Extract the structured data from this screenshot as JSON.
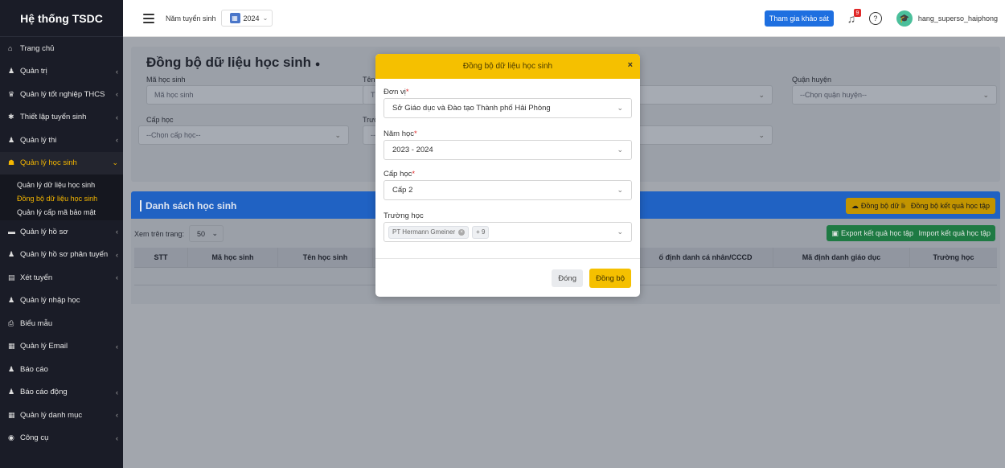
{
  "sidebar": {
    "brand": "Hệ thống TSDC",
    "items": [
      {
        "label": "Trang chủ",
        "icon": "home-icon",
        "glyph": "⌂",
        "chevron": false
      },
      {
        "label": "Quản trị",
        "icon": "users-icon",
        "glyph": "♟",
        "chevron": true
      },
      {
        "label": "Quản lý tốt nghiệp THCS",
        "icon": "trophy-icon",
        "glyph": "♛",
        "chevron": true
      },
      {
        "label": "Thiết lập tuyển sinh",
        "icon": "gear-icon",
        "glyph": "✱",
        "chevron": true
      },
      {
        "label": "Quản lý thi",
        "icon": "user-group-icon",
        "glyph": "♟",
        "chevron": true
      }
    ],
    "active_item": {
      "label": "Quản lý học sinh",
      "glyph": "☗",
      "chevron": "⌄"
    },
    "sub_items": [
      "Quản lý dữ liệu học sinh",
      "Đồng bộ dữ liệu học sinh",
      "Quản lý cấp mã bảo mật"
    ],
    "items_after": [
      {
        "label": "Quản lý hồ sơ",
        "glyph": "▬",
        "chevron": true
      },
      {
        "label": "Quản lý hồ sơ phân tuyến",
        "glyph": "♟",
        "chevron": true
      },
      {
        "label": "Xét tuyển",
        "glyph": "▤",
        "chevron": true
      },
      {
        "label": "Quản lý nhập học",
        "glyph": "♟",
        "chevron": false
      },
      {
        "label": "Biểu mẫu",
        "glyph": "⎙",
        "chevron": false
      },
      {
        "label": "Quản lý Email",
        "glyph": "▦",
        "chevron": true
      },
      {
        "label": "Báo cáo",
        "glyph": "♟",
        "chevron": false
      },
      {
        "label": "Báo cáo động",
        "glyph": "♟",
        "chevron": true
      },
      {
        "label": "Quản lý danh mục",
        "glyph": "▦",
        "chevron": true
      },
      {
        "label": "Công cụ",
        "glyph": "◉",
        "chevron": true
      }
    ]
  },
  "topbar": {
    "year_label": "Năm tuyển sinh",
    "year_value": "2024",
    "survey_button": "Tham gia khảo sát",
    "notification_count": "9",
    "help_glyph": "?",
    "username": "hang_superso_haiphong"
  },
  "filters": {
    "page_title": "Đồng bộ dữ liệu học sinh",
    "student_code_label": "Mã học sinh",
    "student_code_placeholder": "Mã học sinh",
    "partial_label_1": "Tên",
    "partial_placeholder_1": "T",
    "district_label": "Quận huyện",
    "district_value": "--Chọn quận huyện--",
    "level_label": "Cấp học",
    "level_value": "--Chọn cấp học--",
    "partial_label_2": "Trườ",
    "partial_placeholder_2": "--"
  },
  "list": {
    "title": "Danh sách học sinh",
    "sync_data_button": "Đồng bộ dữ liệu",
    "sync_results_button": "Đồng bộ kết quả học tập",
    "export_button": "Export kết quả học tập",
    "import_button": "Import kết quả học tập",
    "per_page_label": "Xem trên trang:",
    "per_page_value": "50",
    "columns": [
      "STT",
      "Mã học sinh",
      "Tên học sinh",
      "",
      "ố định danh cá nhân/CCCD",
      "Mã định danh giáo dục",
      "Trường học"
    ]
  },
  "modal": {
    "title": "Đồng bộ dữ liệu học sinh",
    "close_glyph": "×",
    "unit_label": "Đơn vị",
    "unit_value": "Sở Giáo dục và Đào tạo Thành phố Hải Phòng",
    "year_label": "Năm học",
    "year_value": "2023 - 2024",
    "level_label": "Cấp học",
    "level_value": "Cấp 2",
    "school_label": "Trường học",
    "school_tag": "PT Hermann Gmeiner",
    "school_more": "+ 9",
    "required_mark": "*",
    "close_button": "Đóng",
    "sync_button": "Đồng bộ"
  }
}
